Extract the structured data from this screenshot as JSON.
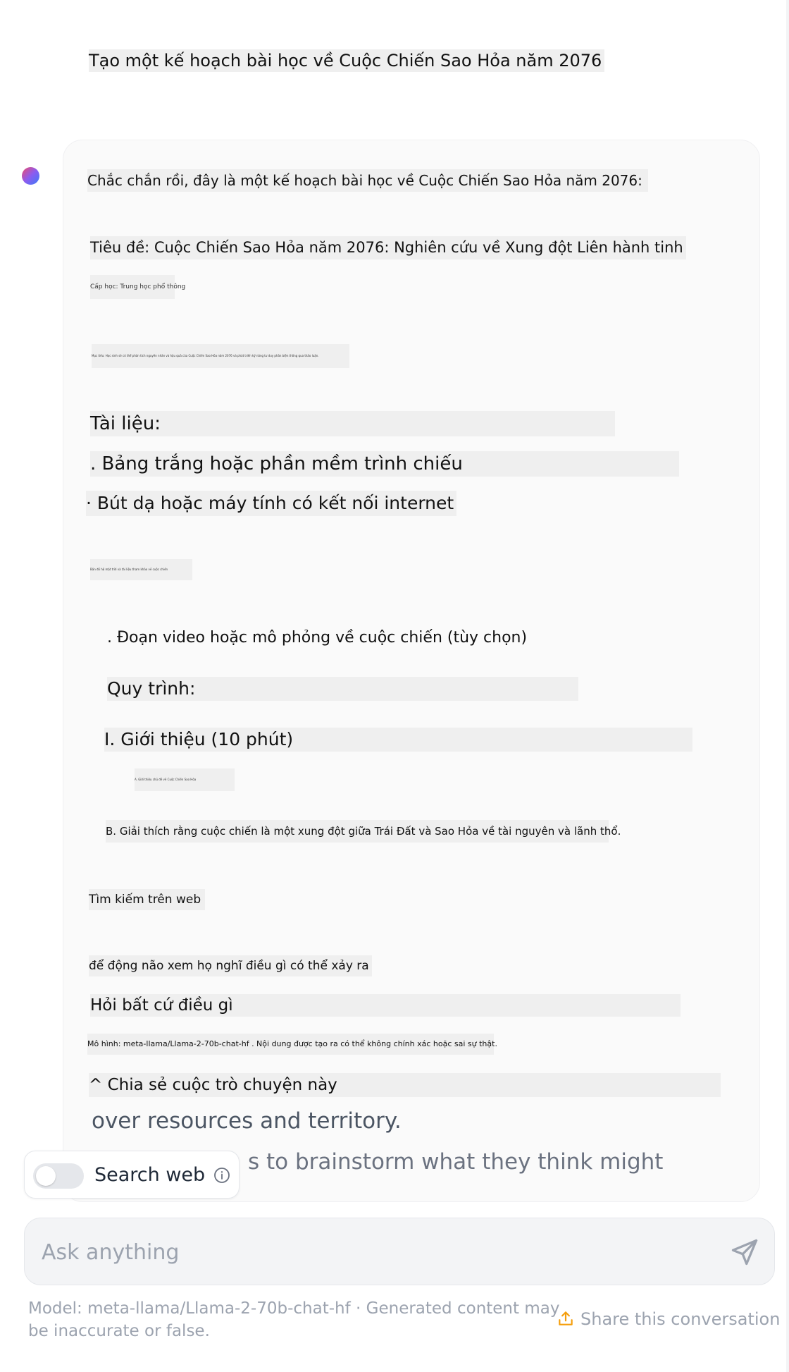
{
  "user_message": "Tạo một kế hoạch bài học về Cuộc Chiến Sao Hỏa năm 2076",
  "assistant": {
    "intro": "Chắc chắn rồi, đây là một kế hoạch bài học về Cuộc Chiến Sao Hỏa năm 2076:",
    "title": "Tiêu đề: Cuộc Chiến Sao Hỏa năm 2076: Nghiên cứu về Xung đột Liên hành tinh",
    "grade_level": "Cấp học: Trung học phổ thông",
    "objective": "Mục tiêu: Học sinh sẽ có thể phân tích nguyên nhân và hậu quả của Cuộc Chiến Sao Hỏa năm 2076 và phát triển kỹ năng tư duy phản biện thông qua thảo luận.",
    "materials_heading": "Tài liệu:",
    "materials": [
      ". Bảng trắng hoặc phần mềm trình chiếu",
      "· Bút dạ hoặc máy tính có kết nối internet",
      "Bản đồ hệ mặt trời và tài liệu tham khảo về cuộc chiến"
    ],
    "video_item": ". Đoạn video hoặc mô phỏng về cuộc chiến (tùy chọn)",
    "procedure_heading": "Quy trình:",
    "intro_section": "I. Giới thiệu (10 phút)",
    "step_a": "A. Giới thiệu chủ đề về Cuộc Chiến Sao Hỏa",
    "step_b": "B. Giải thích rằng cuộc chiến là một xung đột giữa Trái Đất và Sao Hỏa về tài nguyên và lãnh thổ.",
    "web_search_label": "Tìm kiếm trên web",
    "brainstorm_text": "để động não xem họ nghĩ điều gì có thể xảy ra",
    "ask_anything_vi": "Hỏi bất cứ điều gì",
    "model_note_vi": "Mô hình: meta-llama/Llama-2-70b-chat-hf . Nội dung được tạo ra có thể không chính xác hoặc sai sự thật.",
    "share_vi": "^ Chia sẻ cuộc trò chuyện này",
    "faded_line_1": "over resources and territory.",
    "faded_line_2": "s to brainstorm what they think might"
  },
  "search_toggle": {
    "label": "Search web",
    "enabled": false
  },
  "chat_input": {
    "placeholder": "Ask anything",
    "value": ""
  },
  "footer": {
    "disclaimer": "Model: meta-llama/Llama-2-70b-chat-hf · Generated content may be inaccurate or false.",
    "share_label": "Share this conversation"
  },
  "icons": {
    "info": "info-icon",
    "send": "send-icon",
    "share": "share-icon"
  },
  "colors": {
    "avatar_gradient": [
      "#ef4a6a",
      "#8c5cf0",
      "#3b7bf6"
    ],
    "highlight": "#efefef",
    "muted_text": "#9ca3af"
  }
}
